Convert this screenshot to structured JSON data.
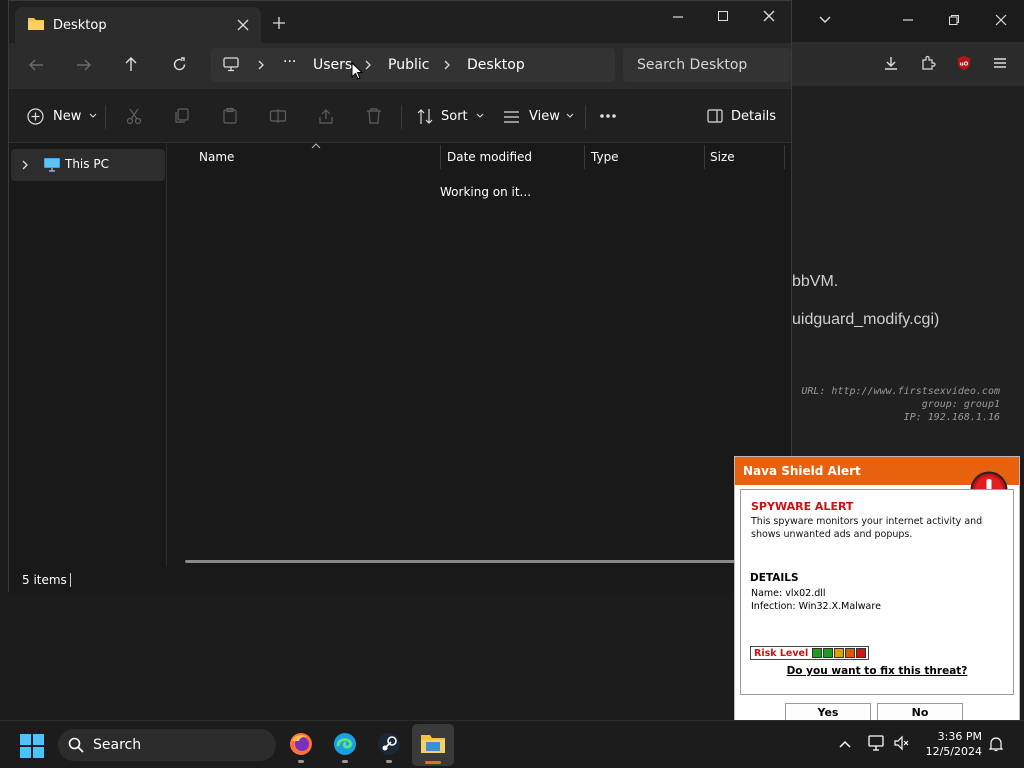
{
  "explorer": {
    "tab_title": "Desktop",
    "breadcrumb": [
      "Users",
      "Public",
      "Desktop"
    ],
    "search_placeholder": "Search Desktop",
    "commands": {
      "new": "New",
      "sort": "Sort",
      "view": "View",
      "details": "Details"
    },
    "nav": {
      "this_pc": "This PC"
    },
    "columns": [
      "Name",
      "Date modified",
      "Type",
      "Size"
    ],
    "loading_text": "Working on it...",
    "status_items": "5 items"
  },
  "background_browser": {
    "line1": "bbVM.",
    "line2": "uidguard_modify.cgi)",
    "url_label": "URL: http://www.firstsexvideo.com",
    "group_label": "group: group1",
    "ip_label": "IP: 192.168.1.16"
  },
  "alert": {
    "title": "Nava Shield Alert",
    "heading": "SPYWARE ALERT",
    "description": "This spyware monitors your internet activity and shows unwanted ads and popups.",
    "details_heading": "DETAILS",
    "name_line": "Name: vlx02.dll",
    "infection_line": "Infection: Win32.X.Malware",
    "risk_label": "Risk Level",
    "risk_colors": [
      "#1e9b1e",
      "#1e9b1e",
      "#e0a000",
      "#d95a00",
      "#c81818"
    ],
    "question": "Do you want to fix this threat?",
    "yes": "Yes",
    "no": "No"
  },
  "taskbar": {
    "search_label": "Search",
    "time": "3:36 PM",
    "date": "12/5/2024"
  },
  "colors": {
    "alert_orange": "#e8610f",
    "alert_red": "#cc1111"
  }
}
